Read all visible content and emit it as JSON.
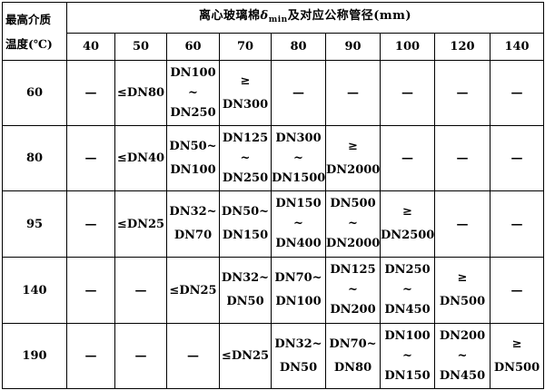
{
  "header": {
    "corner_line1": "最高介质",
    "corner_line2": "温度(℃)",
    "title_pre": "离心玻璃棉",
    "title_symbol": "δ",
    "title_sub": "min",
    "title_post": "及对应公称管径(mm)"
  },
  "thicknesses": [
    "40",
    "50",
    "60",
    "70",
    "80",
    "90",
    "100",
    "120",
    "140"
  ],
  "rows": [
    {
      "temp": "60",
      "cells": [
        [
          "—"
        ],
        [
          "≤DN80"
        ],
        [
          "DN100",
          "~",
          "DN250"
        ],
        [
          "≥",
          "DN300"
        ],
        [
          "—"
        ],
        [
          "—"
        ],
        [
          "—"
        ],
        [
          "—"
        ],
        [
          "—"
        ]
      ]
    },
    {
      "temp": "80",
      "cells": [
        [
          "—"
        ],
        [
          "≤DN40"
        ],
        [
          "DN50~",
          "DN100"
        ],
        [
          "DN125",
          "~",
          "DN250"
        ],
        [
          "DN300",
          "~",
          "DN1500"
        ],
        [
          "≥",
          "DN2000"
        ],
        [
          "—"
        ],
        [
          "—"
        ],
        [
          "—"
        ]
      ]
    },
    {
      "temp": "95",
      "cells": [
        [
          "—"
        ],
        [
          "≤DN25"
        ],
        [
          "DN32~",
          "DN70"
        ],
        [
          "DN50~",
          "DN150"
        ],
        [
          "DN150",
          "~",
          "DN400"
        ],
        [
          "DN500",
          "~",
          "DN2000"
        ],
        [
          "≥",
          "DN2500"
        ],
        [
          "—"
        ],
        [
          "—"
        ]
      ]
    },
    {
      "temp": "140",
      "cells": [
        [
          "—"
        ],
        [
          "—"
        ],
        [
          "≤DN25"
        ],
        [
          "DN32~",
          "DN50"
        ],
        [
          "DN70~",
          "DN100"
        ],
        [
          "DN125",
          "~",
          "DN200"
        ],
        [
          "DN250",
          "~",
          "DN450"
        ],
        [
          "≥",
          "DN500"
        ],
        [
          "—"
        ]
      ]
    },
    {
      "temp": "190",
      "cells": [
        [
          "—"
        ],
        [
          "—"
        ],
        [
          "—"
        ],
        [
          "≤DN25"
        ],
        [
          "DN32~",
          "DN50"
        ],
        [
          "DN70~",
          "DN80"
        ],
        [
          "DN100",
          "~",
          "DN150"
        ],
        [
          "DN200",
          "~",
          "DN450"
        ],
        [
          "≥",
          "DN500"
        ]
      ]
    }
  ]
}
